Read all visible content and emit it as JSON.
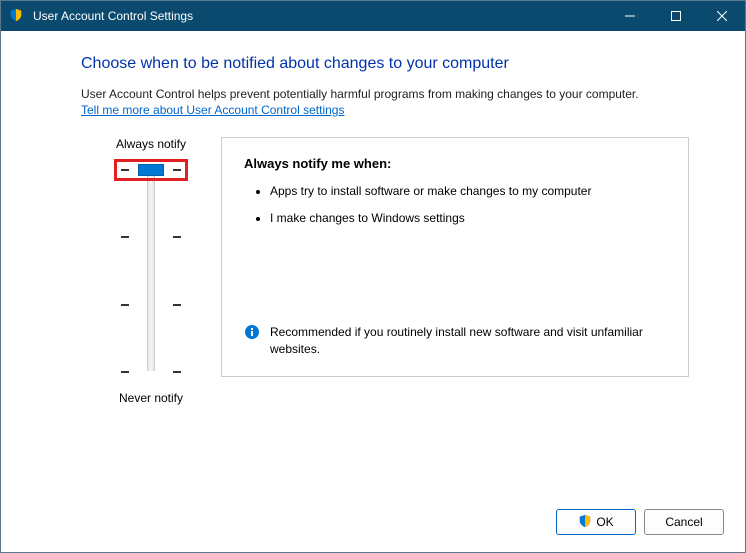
{
  "window": {
    "title": "User Account Control Settings"
  },
  "heading": "Choose when to be notified about changes to your computer",
  "description": "User Account Control helps prevent potentially harmful programs from making changes to your computer.",
  "link_text": "Tell me more about User Account Control settings",
  "slider": {
    "top_label": "Always notify",
    "bottom_label": "Never notify"
  },
  "panel": {
    "title": "Always notify me when:",
    "bullets": [
      "Apps try to install software or make changes to my computer",
      "I make changes to Windows settings"
    ],
    "recommendation": "Recommended if you routinely install new software and visit unfamiliar websites."
  },
  "buttons": {
    "ok": "OK",
    "cancel": "Cancel"
  }
}
